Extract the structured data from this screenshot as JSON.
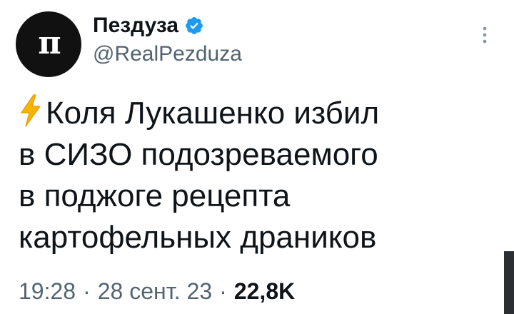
{
  "author": {
    "avatar_text": "п",
    "display_name": "Пездуза",
    "handle": "@RealPezduza",
    "verified": true
  },
  "tweet": {
    "lines": [
      "Коля Лукашенко избил",
      "в СИЗО подозреваемого",
      "в поджоге рецепта",
      "картофельных драников"
    ],
    "leading_icon": "lightning-icon"
  },
  "meta": {
    "time": "19:28",
    "separator": "·",
    "date": "28 сент. 23",
    "views": "22,8K"
  },
  "icons": {
    "verified": "verified-badge-icon",
    "more": "more-vertical-icon"
  },
  "colors": {
    "accent": "#1d9bf0",
    "text": "#0f1419",
    "secondary": "#536471",
    "lightning": "#f7b500"
  }
}
